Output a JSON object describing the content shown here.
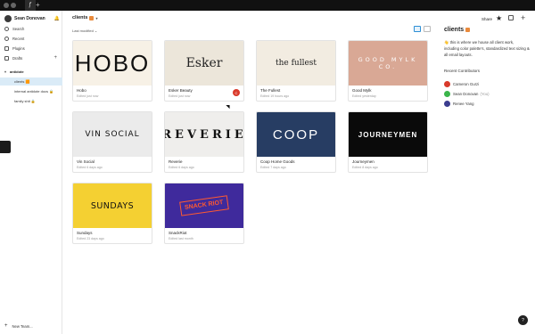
{
  "titlebar": {
    "window_controls": [
      "close",
      "minimize",
      "maximize"
    ],
    "tab_icon": "figma-icon",
    "new_tab": "+"
  },
  "sidebar": {
    "user_name": "Sean Donovan",
    "nav": [
      {
        "label": "Search",
        "icon": "search-icon"
      },
      {
        "label": "Recent",
        "icon": "clock-icon"
      },
      {
        "label": "Plugins",
        "icon": "plugin-icon"
      },
      {
        "label": "Drafts",
        "icon": "file-icon",
        "add": "+"
      }
    ],
    "team": "antidote",
    "projects": [
      {
        "label": "clients 🟧",
        "active": true
      },
      {
        "label": "internal antidote docs 🔒",
        "active": false
      },
      {
        "label": "family shit 🔒",
        "active": false
      }
    ],
    "new_team": "New Team..."
  },
  "main": {
    "title": "clients",
    "sort_label": "Last modified",
    "sort_caret": "⌄",
    "cards": [
      {
        "thumb_text": "HOBO",
        "style": "hobo",
        "bg": "#f7f1e6",
        "title": "Hobo",
        "subtitle": "Edited just now"
      },
      {
        "thumb_text": "Esker",
        "style": "esker",
        "bg": "#ece6da",
        "title": "Esker Beauty",
        "subtitle": "Edited just now",
        "badge": "C"
      },
      {
        "thumb_text": "the fullest",
        "style": "fullest",
        "bg": "#f2ece1",
        "title": "The Fullest",
        "subtitle": "Edited 19 hours ago"
      },
      {
        "thumb_text": "GOOD MYLK CO.",
        "style": "goodmylk",
        "bg": "#d9a895",
        "title": "Good Mylk",
        "subtitle": "Edited yesterday"
      },
      {
        "thumb_text": "VIN SOCIAL",
        "style": "vin",
        "bg": "#ebebeb",
        "title": "Vin Social",
        "subtitle": "Edited 6 days ago"
      },
      {
        "thumb_text": "REVERIE",
        "style": "reverie",
        "bg": "#efeeec",
        "title": "Reverie",
        "subtitle": "Edited 6 days ago"
      },
      {
        "thumb_text": "COOP",
        "style": "coop",
        "bg": "#273d63",
        "title": "Coop Home Goods",
        "subtitle": "Edited 7 days ago"
      },
      {
        "thumb_text": "JOURNEYMEN",
        "style": "journey",
        "bg": "#0a0a0a",
        "title": "Journeymen",
        "subtitle": "Edited 8 days ago"
      },
      {
        "thumb_text": "SUNDAYS",
        "style": "sundays",
        "bg": "#f4d032",
        "title": "Sundays",
        "subtitle": "Edited 23 days ago"
      },
      {
        "thumb_text": "SNACK RIOT",
        "style": "snack",
        "bg": "#3f2a9c",
        "title": "SnackRiot",
        "subtitle": "Edited last month"
      }
    ]
  },
  "right_panel": {
    "share": "Share",
    "title": "clients",
    "description": "this is where we house all client work, including color palette's, standardized text sizing & all email layouts.",
    "contributors_heading": "Recent Contributors",
    "contributors": [
      {
        "name": "Cameron Gurzi",
        "you": "",
        "color": "#d93a2b"
      },
      {
        "name": "Sean Donovan",
        "you": "(You)",
        "color": "#3ab54a"
      },
      {
        "name": "Renee Yang",
        "you": "",
        "color": "#3b3d8f"
      }
    ],
    "help": "?"
  },
  "colors": {
    "accent": "#2d8fd5",
    "active_project_bg": "#daebf7"
  }
}
